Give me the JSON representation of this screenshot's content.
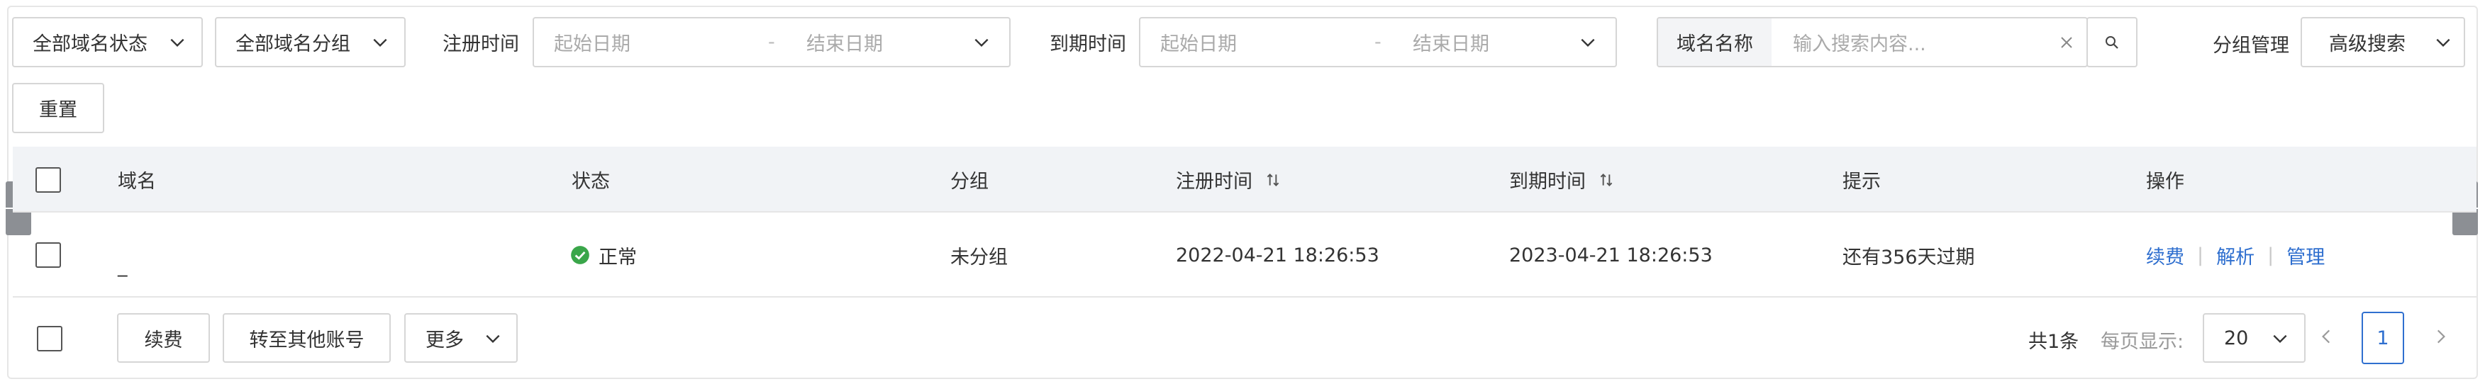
{
  "filters": {
    "status_select": "全部域名状态",
    "group_select": "全部域名分组",
    "reg_time_label": "注册时间",
    "reg_start_placeholder": "起始日期",
    "reg_range_sep": "-",
    "reg_end_placeholder": "结束日期",
    "exp_time_label": "到期时间",
    "exp_start_placeholder": "起始日期",
    "exp_range_sep": "-",
    "exp_end_placeholder": "结束日期",
    "search_prefix": "域名名称",
    "search_placeholder": "输入搜索内容...",
    "group_manage": "分组管理",
    "advanced_search": "高级搜索",
    "reset": "重置"
  },
  "table": {
    "columns": [
      "域名",
      "状态",
      "分组",
      "注册时间",
      "到期时间",
      "提示",
      "操作"
    ],
    "rows": [
      {
        "domain": "_",
        "status": "正常",
        "group": "未分组",
        "reg_time": "2022-04-21 18:26:53",
        "exp_time": "2023-04-21 18:26:53",
        "hint": "还有356天过期",
        "actions": [
          "续费",
          "解析",
          "管理"
        ]
      }
    ]
  },
  "footer": {
    "renew": "续费",
    "transfer": "转至其他账号",
    "more": "更多",
    "total": "共1条",
    "per_page_label": "每页显示:",
    "per_page_value": "20",
    "current_page": "1"
  },
  "colors": {
    "status_ok": "#3aa64a",
    "link": "#2f6fcf",
    "header_bg": "#f1f3f6",
    "page_active": "#2f6fcf"
  },
  "icons": {
    "chevron": "chevron-down-icon",
    "clear": "close-icon",
    "search": "search-icon",
    "sort": "sort-icon",
    "status": "check-circle-icon"
  }
}
